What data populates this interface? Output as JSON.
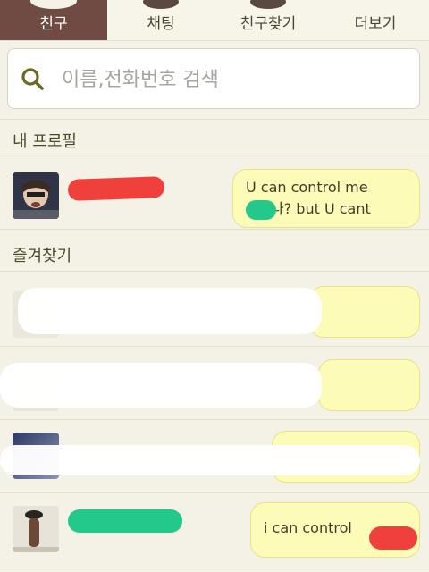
{
  "tabs": [
    {
      "label": "친구",
      "active": true
    },
    {
      "label": "채팅",
      "active": false
    },
    {
      "label": "친구찾기",
      "active": false
    },
    {
      "label": "더보기",
      "active": false
    }
  ],
  "search": {
    "placeholder": "이름,전화번호 검색"
  },
  "sections": {
    "my_profile": "내 프로필",
    "favorites": "즐겨찾기"
  },
  "my_profile": {
    "status_line1": "U can control me",
    "status_line2": "나? but U cant"
  },
  "favorites": [
    {
      "status": ""
    },
    {
      "status": ""
    },
    {
      "status": ""
    },
    {
      "status": "i can control"
    }
  ],
  "colors": {
    "active_tab": "#6f4b44",
    "bubble": "#fdfbb8",
    "redact_red": "#f0403c",
    "redact_green": "#22c98a"
  }
}
